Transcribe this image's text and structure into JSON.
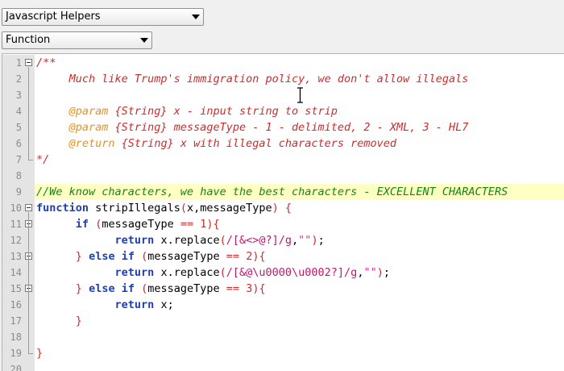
{
  "toolbar": {
    "dropdown1": {
      "value": "Javascript Helpers"
    },
    "dropdown2": {
      "value": "Function"
    }
  },
  "editor": {
    "line_numbers": [
      "1",
      "2",
      "3",
      "4",
      "5",
      "6",
      "7",
      "8",
      "9",
      "10",
      "11",
      "12",
      "13",
      "14",
      "15",
      "16",
      "17",
      "18",
      "19",
      "20"
    ],
    "highlighted_line": 9,
    "lines": [
      {
        "tokens": [
          {
            "c": "cm",
            "t": "/**"
          }
        ]
      },
      {
        "tokens": [
          {
            "c": "cm",
            "t": "     Much like Trump's immigration policy, we don't allow illegals"
          }
        ]
      },
      {
        "tokens": []
      },
      {
        "tokens": [
          {
            "c": "tag",
            "t": "     @param"
          },
          {
            "c": "cm",
            "t": " {String} x - input string to strip"
          }
        ]
      },
      {
        "tokens": [
          {
            "c": "tag",
            "t": "     @param"
          },
          {
            "c": "cm",
            "t": " {String} messageType - 1 - delimited, 2 - XML, 3 - HL7"
          }
        ]
      },
      {
        "tokens": [
          {
            "c": "tag",
            "t": "     @return"
          },
          {
            "c": "cm",
            "t": " {String} x with illegal characters removed"
          }
        ]
      },
      {
        "tokens": [
          {
            "c": "cm",
            "t": "*/"
          }
        ]
      },
      {
        "tokens": []
      },
      {
        "tokens": [
          {
            "c": "cm-green",
            "t": "//We know characters, we have the best characters - EXCELLENT CHARACTERS"
          }
        ]
      },
      {
        "tokens": [
          {
            "c": "kw",
            "t": "function"
          },
          {
            "c": "",
            "t": " stripIllegals"
          },
          {
            "c": "pn",
            "t": "("
          },
          {
            "c": "",
            "t": "x,messageType"
          },
          {
            "c": "pn",
            "t": ") {"
          }
        ]
      },
      {
        "tokens": [
          {
            "c": "",
            "t": "      "
          },
          {
            "c": "kw",
            "t": "if"
          },
          {
            "c": "",
            "t": " "
          },
          {
            "c": "pn",
            "t": "("
          },
          {
            "c": "",
            "t": "messageType "
          },
          {
            "c": "pn",
            "t": "=="
          },
          {
            "c": "",
            "t": " "
          },
          {
            "c": "pn",
            "t": "1){"
          }
        ]
      },
      {
        "tokens": [
          {
            "c": "",
            "t": "            "
          },
          {
            "c": "kw",
            "t": "return"
          },
          {
            "c": "",
            "t": " x.replace"
          },
          {
            "c": "pn",
            "t": "("
          },
          {
            "c": "rx",
            "t": "/[&<>@?]/g"
          },
          {
            "c": "",
            "t": ","
          },
          {
            "c": "st",
            "t": "\"\""
          },
          {
            "c": "pn",
            "t": ")"
          },
          {
            "c": "",
            "t": ";"
          }
        ]
      },
      {
        "tokens": [
          {
            "c": "",
            "t": "      "
          },
          {
            "c": "pn",
            "t": "}"
          },
          {
            "c": "",
            "t": " "
          },
          {
            "c": "kw",
            "t": "else if"
          },
          {
            "c": "",
            "t": " "
          },
          {
            "c": "pn",
            "t": "("
          },
          {
            "c": "",
            "t": "messageType "
          },
          {
            "c": "pn",
            "t": "=="
          },
          {
            "c": "",
            "t": " "
          },
          {
            "c": "pn",
            "t": "2){"
          }
        ]
      },
      {
        "tokens": [
          {
            "c": "",
            "t": "            "
          },
          {
            "c": "kw",
            "t": "return"
          },
          {
            "c": "",
            "t": " x.replace"
          },
          {
            "c": "pn",
            "t": "("
          },
          {
            "c": "rx",
            "t": "/[&@\\u0000\\u0002?]/g"
          },
          {
            "c": "",
            "t": ","
          },
          {
            "c": "st",
            "t": "\"\""
          },
          {
            "c": "pn",
            "t": ")"
          },
          {
            "c": "",
            "t": ";"
          }
        ]
      },
      {
        "tokens": [
          {
            "c": "",
            "t": "      "
          },
          {
            "c": "pn",
            "t": "}"
          },
          {
            "c": "",
            "t": " "
          },
          {
            "c": "kw",
            "t": "else if"
          },
          {
            "c": "",
            "t": " "
          },
          {
            "c": "pn",
            "t": "("
          },
          {
            "c": "",
            "t": "messageType "
          },
          {
            "c": "pn",
            "t": "=="
          },
          {
            "c": "",
            "t": " "
          },
          {
            "c": "pn",
            "t": "3){"
          }
        ]
      },
      {
        "tokens": [
          {
            "c": "",
            "t": "            "
          },
          {
            "c": "kw",
            "t": "return"
          },
          {
            "c": "",
            "t": " x;"
          }
        ]
      },
      {
        "tokens": [
          {
            "c": "",
            "t": "      "
          },
          {
            "c": "pn",
            "t": "}"
          }
        ]
      },
      {
        "tokens": []
      },
      {
        "tokens": [
          {
            "c": "pn",
            "t": "}"
          }
        ]
      },
      {
        "tokens": []
      }
    ],
    "fold_starts": [
      1,
      10,
      11,
      13,
      15
    ],
    "fold_spans": [
      {
        "from": 1,
        "to": 7
      },
      {
        "from": 10,
        "to": 19
      }
    ]
  },
  "colors": {
    "comment": "#d02b2b",
    "doc_tag": "#e8901e",
    "keyword": "#1d3fb5",
    "regex": "#c2186c",
    "string": "#e0309a",
    "line_comment": "#118811",
    "highlight_line": "#ffffc4"
  },
  "icons": [
    "chevron-down-icon",
    "fold-toggle-icon",
    "text-cursor-icon"
  ]
}
